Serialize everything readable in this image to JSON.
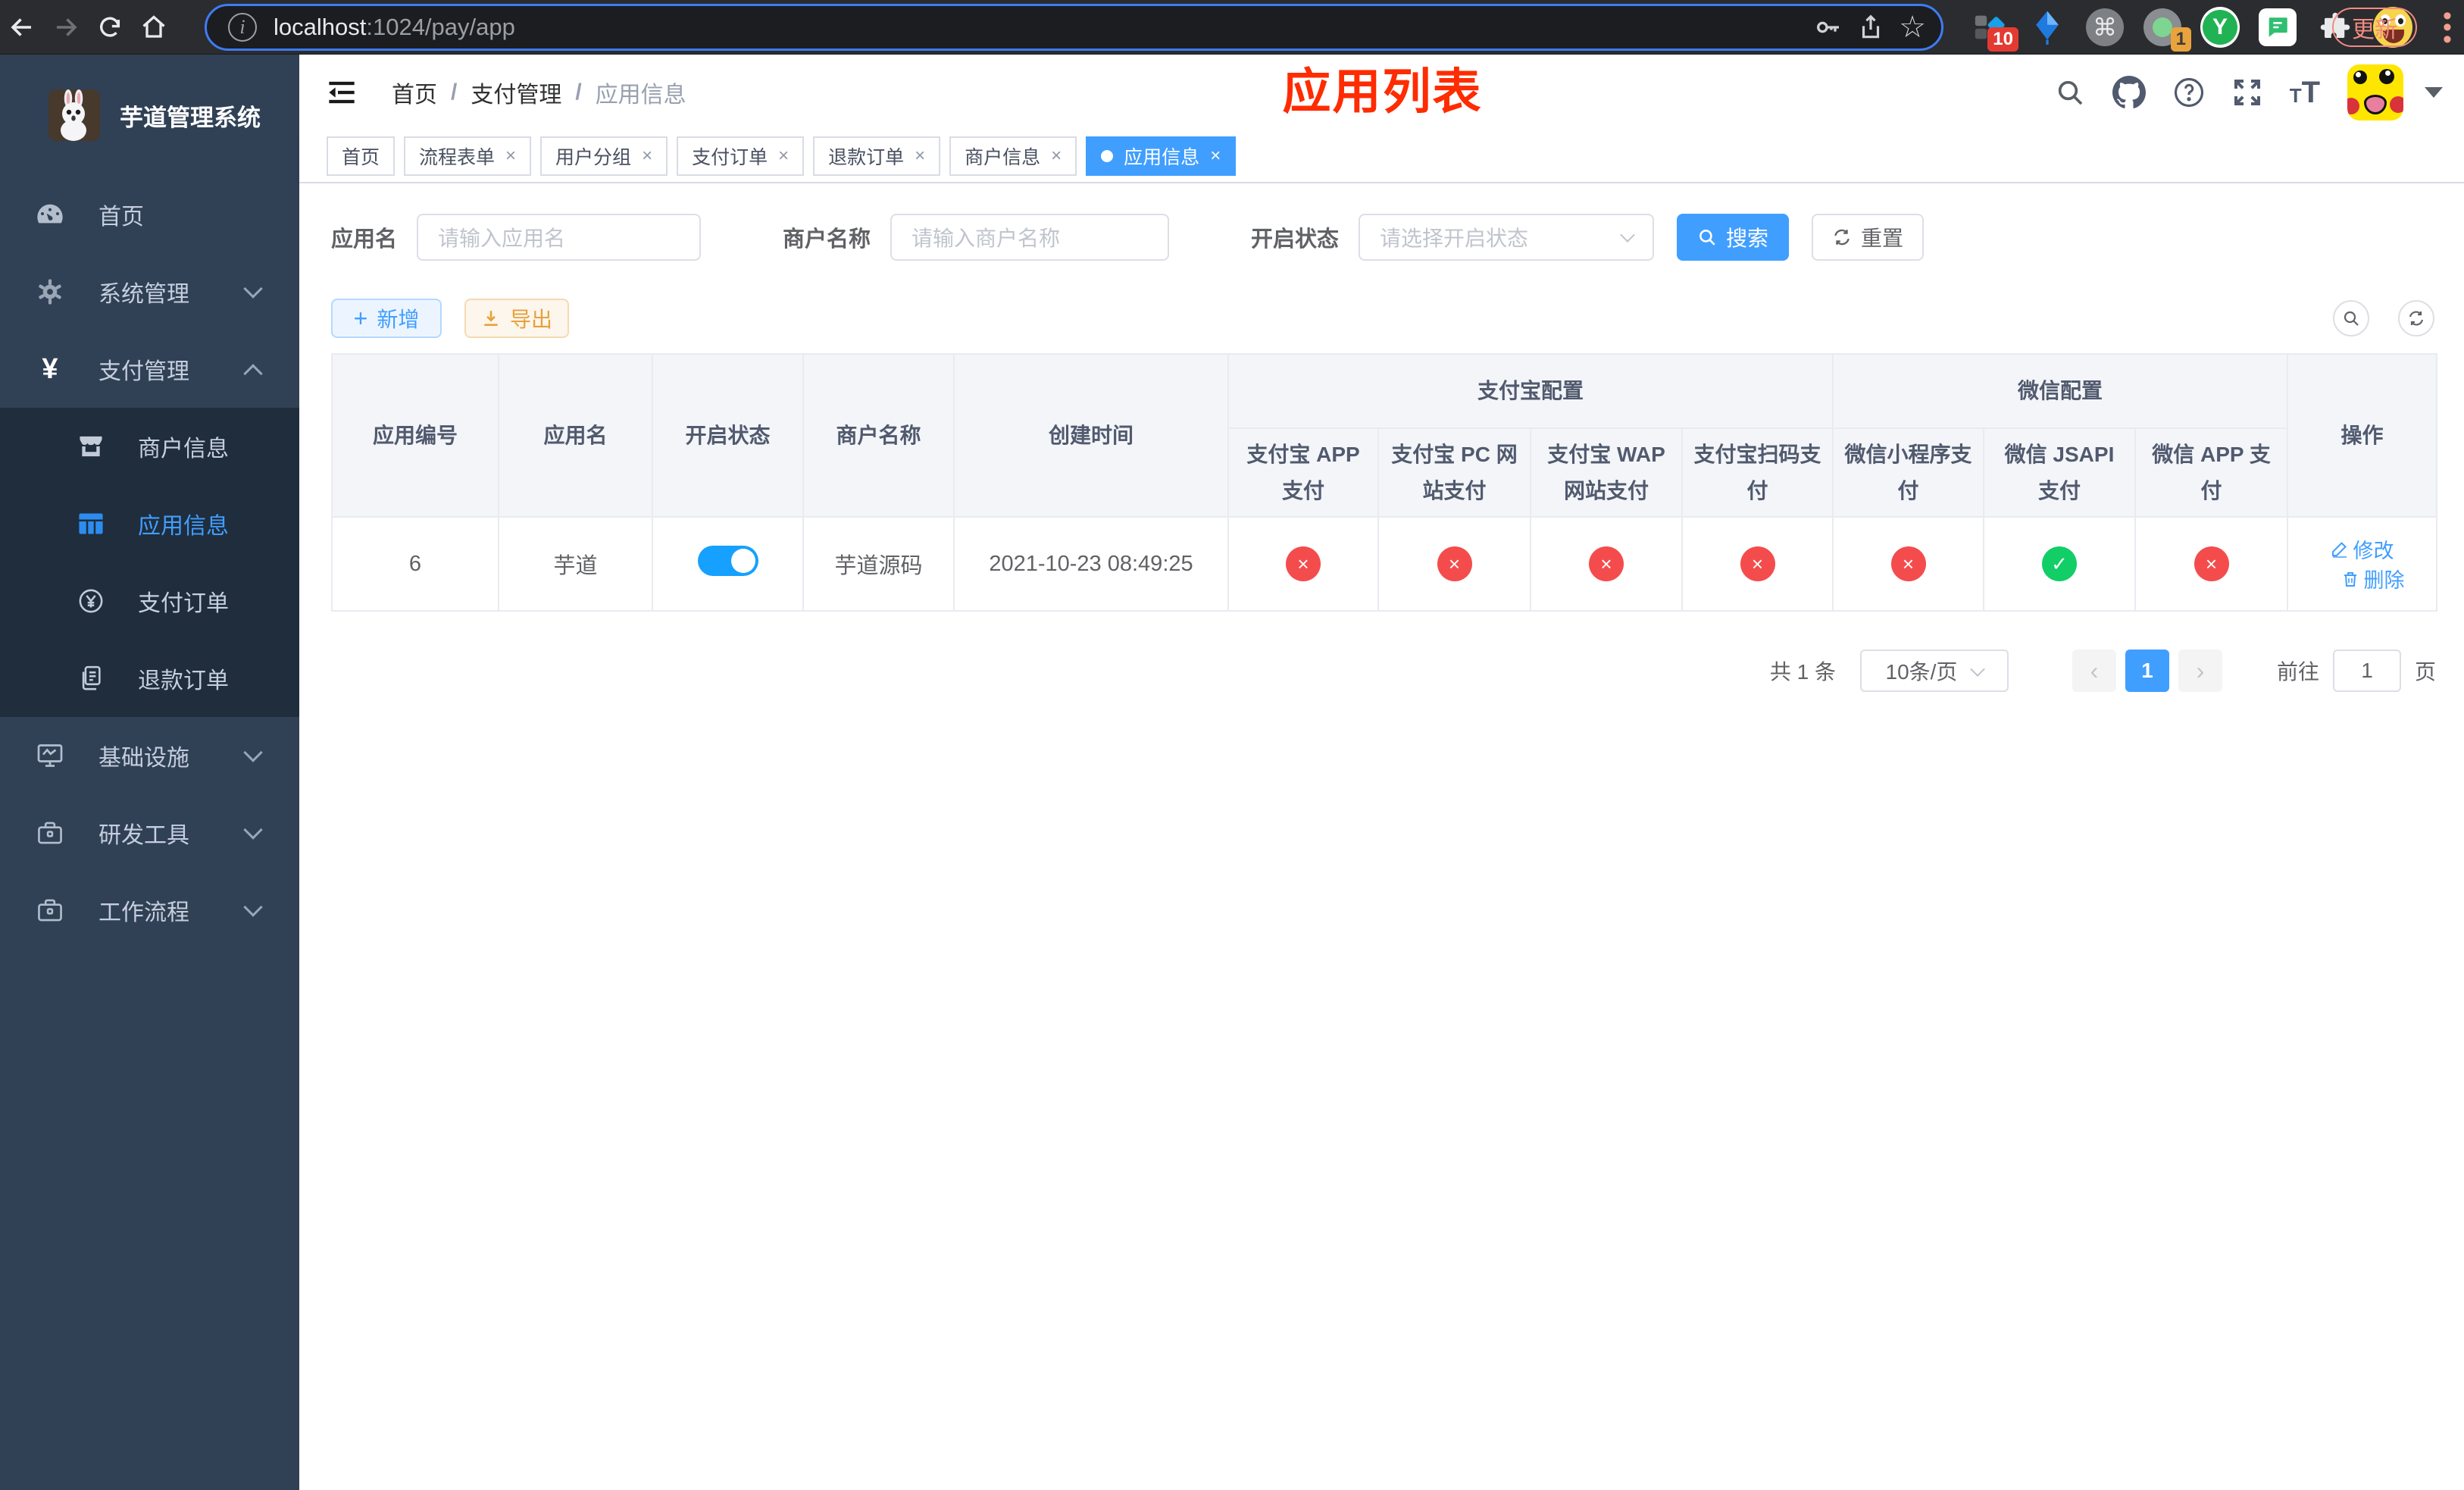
{
  "browser": {
    "url_host": "localhost",
    "url_path": ":1024/pay/app",
    "ext_badge_layout": "10",
    "ext_badge_proxy": "1",
    "ext_y_letter": "Y",
    "cmd_glyph": "⌘",
    "update_label": "更新"
  },
  "sidebar": {
    "title": "芋道管理系统",
    "top": [
      {
        "label": "首页"
      },
      {
        "label": "系统管理"
      },
      {
        "label": "支付管理"
      }
    ],
    "submenu": [
      {
        "label": "商户信息"
      },
      {
        "label": "应用信息",
        "active": true
      },
      {
        "label": "支付订单"
      },
      {
        "label": "退款订单"
      }
    ],
    "bottom": [
      {
        "label": "基础设施"
      },
      {
        "label": "研发工具"
      },
      {
        "label": "工作流程"
      }
    ],
    "yen_glyph": "¥"
  },
  "header": {
    "breadcrumb": [
      "首页",
      "支付管理",
      "应用信息"
    ],
    "sep": "/",
    "overlay_title": "应用列表"
  },
  "tabs": [
    {
      "label": "首页",
      "closable": false
    },
    {
      "label": "流程表单",
      "closable": true
    },
    {
      "label": "用户分组",
      "closable": true
    },
    {
      "label": "支付订单",
      "closable": true
    },
    {
      "label": "退款订单",
      "closable": true
    },
    {
      "label": "商户信息",
      "closable": true
    },
    {
      "label": "应用信息",
      "closable": true,
      "active": true
    }
  ],
  "close_glyph": "×",
  "filters": {
    "app_name_label": "应用名",
    "app_name_placeholder": "请输入应用名",
    "merchant_label": "商户名称",
    "merchant_placeholder": "请输入商户名称",
    "status_label": "开启状态",
    "status_placeholder": "请选择开启状态",
    "search_label": "搜索",
    "reset_label": "重置"
  },
  "toolbar": {
    "add_label": "新增",
    "add_plus": "+",
    "export_label": "导出"
  },
  "table": {
    "groups": {
      "alipay": "支付宝配置",
      "wechat": "微信配置"
    },
    "columns": [
      "应用编号",
      "应用名",
      "开启状态",
      "商户名称",
      "创建时间",
      "支付宝 APP 支付",
      "支付宝 PC 网站支付",
      "支付宝 WAP 网站支付",
      "支付宝扫码支付",
      "微信小程序支付",
      "微信 JSAPI 支付",
      "微信 APP 支付",
      "操作"
    ],
    "row": {
      "id": "6",
      "name": "芋道",
      "enabled": true,
      "merchant": "芋道源码",
      "created": "2021-10-23 08:49:25",
      "statuses": [
        {
          "ok": false,
          "glyph": "×"
        },
        {
          "ok": false,
          "glyph": "×"
        },
        {
          "ok": false,
          "glyph": "×"
        },
        {
          "ok": false,
          "glyph": "×"
        },
        {
          "ok": false,
          "glyph": "×"
        },
        {
          "ok": true,
          "glyph": "✓"
        },
        {
          "ok": false,
          "glyph": "×"
        }
      ],
      "edit_label": "修改",
      "delete_label": "删除"
    }
  },
  "pagination": {
    "total": "共 1 条",
    "per_page": "10条/页",
    "prev": "‹",
    "page": "1",
    "next": "›",
    "goto_label": "前往",
    "goto_value": "1",
    "goto_suffix": "页"
  }
}
